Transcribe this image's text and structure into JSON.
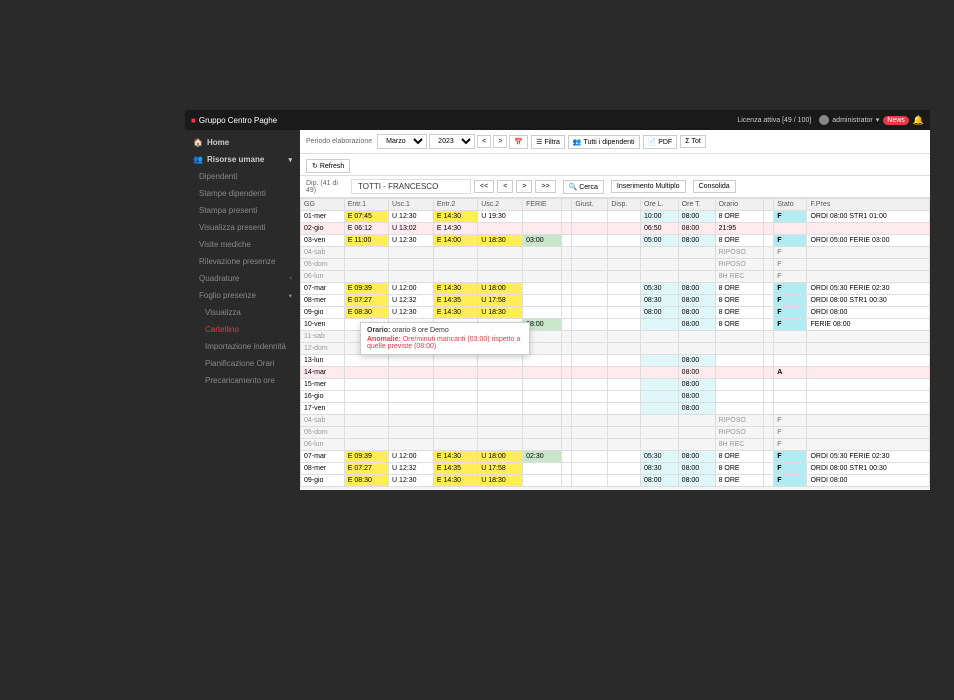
{
  "topbar": {
    "brand": "Gruppo Centro Paghe",
    "license": "Licenza attiva [49 / 100]",
    "user": "administrator",
    "news": "News"
  },
  "sidebar": {
    "home": "Home",
    "hr": "Risorse umane",
    "items": [
      "Dipendenti",
      "Stampe dipendenti",
      "Stampa presenti",
      "Visualizza presenti",
      "Visite mediche",
      "Rilevazione presenze",
      "Quadrature"
    ],
    "foglio": "Foglio presenze",
    "foglio_sub": [
      "Visualizza",
      "Cartellino",
      "Importazione indennità",
      "Pianificazione Orari",
      "Precaricamento ore"
    ]
  },
  "toolbar": {
    "periodo_lbl": "Periodo elaborazione",
    "month": "Marzo",
    "year": "2023",
    "filtra": "Filtra",
    "tutti": "Tutti i dipendenti",
    "pdf": "PDF",
    "tot": "Tot",
    "refresh": "Refresh"
  },
  "emp": {
    "info": "Dip. (41 di 49)",
    "name": "TOTTI - FRANCESCO",
    "cerca": "Cerca",
    "ins_mult": "Inserimento Multiplo",
    "consolida": "Consolida"
  },
  "headers": [
    "GG",
    "Entr.1",
    "Usc.1",
    "Entr.2",
    "Usc.2",
    "FERIE",
    "",
    "Giust.",
    "Disp.",
    "Ore L.",
    "Ore T.",
    "Orario",
    "",
    "Stato",
    "F.Pres"
  ],
  "rows": [
    {
      "d": "01-mer",
      "e1": "E 07:45",
      "u1": "U 12:30",
      "e2": "E 14:30",
      "u2": "U 19:30",
      "cls": [
        "",
        "yellow",
        "",
        "yellow",
        "",
        ""
      ],
      "ol": "10:00",
      "ot": "08:00",
      "or": "8 ORE",
      "st": "F",
      "fp": "ORDI 08:00 STR1 01:00"
    },
    {
      "d": "02-gio",
      "e1": "E 06:12",
      "u1": "U 13:02",
      "e2": "E 14:30",
      "u2": "",
      "cls": [
        "",
        "yellow",
        "",
        "pink",
        "",
        ""
      ],
      "ol": "06:50",
      "ot": "08:00",
      "or": "21:95",
      "st": "",
      "fp": "",
      "anomaly": true
    },
    {
      "d": "03-ven",
      "e1": "E 11:00",
      "u1": "U 12:30",
      "e2": "E 14:00",
      "u2": "U 18:30",
      "f": "03:00",
      "cls": [
        "",
        "yellow",
        "",
        "yellow",
        "yellow",
        "mint"
      ],
      "ol": "05:00",
      "ot": "08:00",
      "or": "8 ORE",
      "st": "F",
      "fp": "ORDI 05:00 FERIE 03:00"
    },
    {
      "d": "04-sab",
      "weekend": true,
      "or": "RIPOSO",
      "st": "F"
    },
    {
      "d": "05-dom",
      "weekend": true,
      "or": "RIPOSO",
      "st": "F"
    },
    {
      "d": "06-lun",
      "weekend": true,
      "or": "8H REC",
      "st": "F"
    },
    {
      "d": "07-mar",
      "e1": "E 09:39",
      "u1": "U 12:00",
      "e2": "E 14:30",
      "u2": "U 18:00",
      "cls": [
        "",
        "yellow",
        "",
        "yellow",
        "yellow",
        ""
      ],
      "ol": "05:30",
      "ot": "08:00",
      "or": "8 ORE",
      "st": "F",
      "fp": "ORDI 05:30 FERIE 02:30"
    },
    {
      "d": "08-mer",
      "e1": "E 07:27",
      "u1": "U 12:32",
      "e2": "E 14:35",
      "u2": "U 17:58",
      "cls": [
        "",
        "yellow",
        "",
        "yellow",
        "yellow",
        ""
      ],
      "ol": "08:30",
      "ot": "08:00",
      "or": "8 ORE",
      "st": "F",
      "fp": "ORDI 08:00 STR1 00:30"
    },
    {
      "d": "09-gio",
      "e1": "E 08:30",
      "u1": "U 12:30",
      "e2": "E 14:30",
      "u2": "U 18:30",
      "cls": [
        "",
        "yellow",
        "",
        "yellow",
        "yellow",
        ""
      ],
      "ol": "08:00",
      "ot": "08:00",
      "or": "8 ORE",
      "st": "F",
      "fp": "ORDI 08:00"
    },
    {
      "d": "10-ven",
      "f": "08:00",
      "cls": [
        "",
        "",
        "",
        "",
        "",
        "mint"
      ],
      "ol": "",
      "ot": "08:00",
      "or": "8 ORE",
      "st": "F",
      "fp": "FERIE 08:00"
    },
    {
      "d": "11-sab",
      "weekend": true
    },
    {
      "d": "12-dom",
      "weekend": true
    },
    {
      "d": "13-lun",
      "ot": "08:00"
    },
    {
      "d": "14-mar",
      "ot": "08:00",
      "st": "A",
      "anomaly": true
    },
    {
      "d": "15-mer",
      "ot": "08:00"
    },
    {
      "d": "16-gio",
      "ot": "08:00"
    },
    {
      "d": "17-ven",
      "ot": "08:00"
    },
    {
      "d": "04-sab",
      "weekend": true,
      "or": "RIPOSO",
      "st": "F"
    },
    {
      "d": "05-dom",
      "weekend": true,
      "or": "RIPOSO",
      "st": "F"
    },
    {
      "d": "06-lun",
      "weekend": true,
      "or": "8H REC",
      "st": "F"
    },
    {
      "d": "07-mar",
      "e1": "E 09:39",
      "u1": "U 12:00",
      "e2": "E 14:30",
      "u2": "U 18:00",
      "f": "02:30",
      "cls": [
        "",
        "yellow",
        "",
        "yellow",
        "yellow",
        "mint"
      ],
      "ol": "05:30",
      "ot": "08:00",
      "or": "8 ORE",
      "st": "F",
      "fp": "ORDI 05:30 FERIE 02:30"
    },
    {
      "d": "08-mer",
      "e1": "E 07:27",
      "u1": "U 12:32",
      "e2": "E 14:35",
      "u2": "U 17:58",
      "cls": [
        "",
        "yellow",
        "",
        "yellow",
        "yellow",
        ""
      ],
      "ol": "08:30",
      "ot": "08:00",
      "or": "8 ORE",
      "st": "F",
      "fp": "ORDI 08:00 STR1 00:30"
    },
    {
      "d": "09-gio",
      "e1": "E 08:30",
      "u1": "U 12:30",
      "e2": "E 14:30",
      "u2": "U 18:30",
      "cls": [
        "",
        "yellow",
        "",
        "yellow",
        "yellow",
        ""
      ],
      "ol": "08:00",
      "ot": "08:00",
      "or": "8 ORE",
      "st": "F",
      "fp": "ORDI 08:00"
    }
  ],
  "tooltip": {
    "orario_lbl": "Orario:",
    "orario_val": "orario 8 ore Demo",
    "anomalie_lbl": "Anomalie:",
    "anomalie_val": "Ore/minuti mancanti (03:00) rispetto a quelle previste (08:00)"
  }
}
